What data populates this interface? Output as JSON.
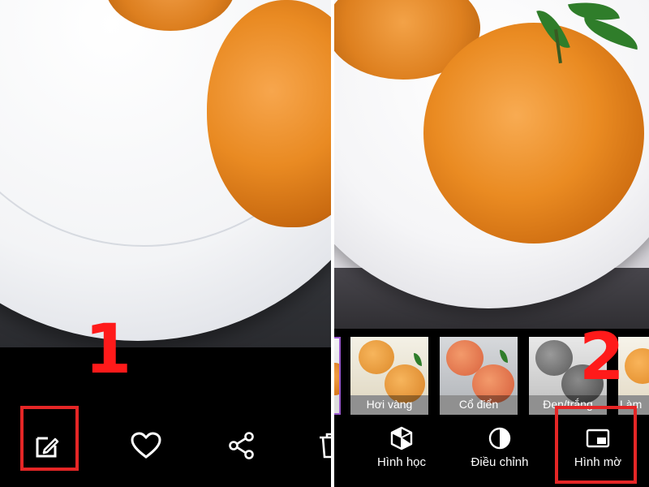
{
  "annotations": {
    "step1": "1",
    "step2": "2",
    "highlight_color": "#e52626"
  },
  "left_screen": {
    "bottom_actions": [
      {
        "icon": "edit-icon"
      },
      {
        "icon": "heart-icon"
      },
      {
        "icon": "share-icon"
      },
      {
        "icon": "trash-icon"
      }
    ]
  },
  "right_screen": {
    "filters": [
      {
        "label": "Hơi vàng"
      },
      {
        "label": "Cổ điển"
      },
      {
        "label": "Đen/trắng"
      },
      {
        "label": "Làm"
      }
    ],
    "tools": [
      {
        "label": "Hình học",
        "icon": "geometry-icon"
      },
      {
        "label": "Điều chỉnh",
        "icon": "adjust-icon"
      },
      {
        "label": "Hình mờ",
        "icon": "watermark-icon"
      }
    ]
  }
}
